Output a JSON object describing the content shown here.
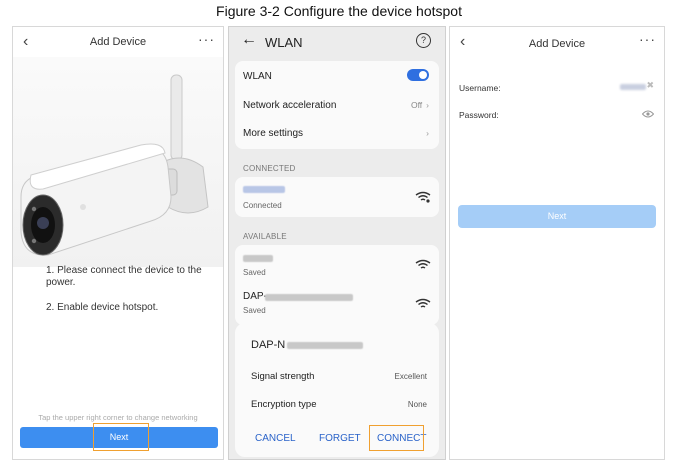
{
  "figure_title": "Figure 3-2 Configure the device hotspot",
  "screen1": {
    "title": "Add Device",
    "instructions": [
      "1. Please connect the device to the power.",
      "2. Enable device hotspot."
    ],
    "hint": "Tap the upper right corner to change networking",
    "next_label": "Next"
  },
  "screen2": {
    "title": "WLAN",
    "wlan_label": "WLAN",
    "network_acceleration_label": "Network acceleration",
    "network_acceleration_value": "Off",
    "more_settings_label": "More settings",
    "connected_section": "CONNECTED",
    "connected_status": "Connected",
    "available_section": "AVAILABLE",
    "available_networks": [
      {
        "name": "",
        "status": "Saved"
      },
      {
        "name": "DAP-",
        "status": "Saved"
      }
    ],
    "sheet": {
      "network_name": "DAP-N",
      "signal_strength_label": "Signal strength",
      "signal_strength_value": "Excellent",
      "encryption_label": "Encryption type",
      "encryption_value": "None",
      "cancel_label": "CANCEL",
      "forget_label": "FORGET",
      "connect_label": "CONNECT"
    }
  },
  "screen3": {
    "title": "Add Device",
    "username_label": "Username:",
    "password_label": "Password:",
    "next_label": "Next"
  },
  "colors": {
    "primary_button": "#3d8ef0",
    "disabled_button": "#a5cdf7",
    "toggle_on": "#2f6fe0",
    "action_text": "#2a63c9",
    "highlight_box": "#f0a030"
  }
}
